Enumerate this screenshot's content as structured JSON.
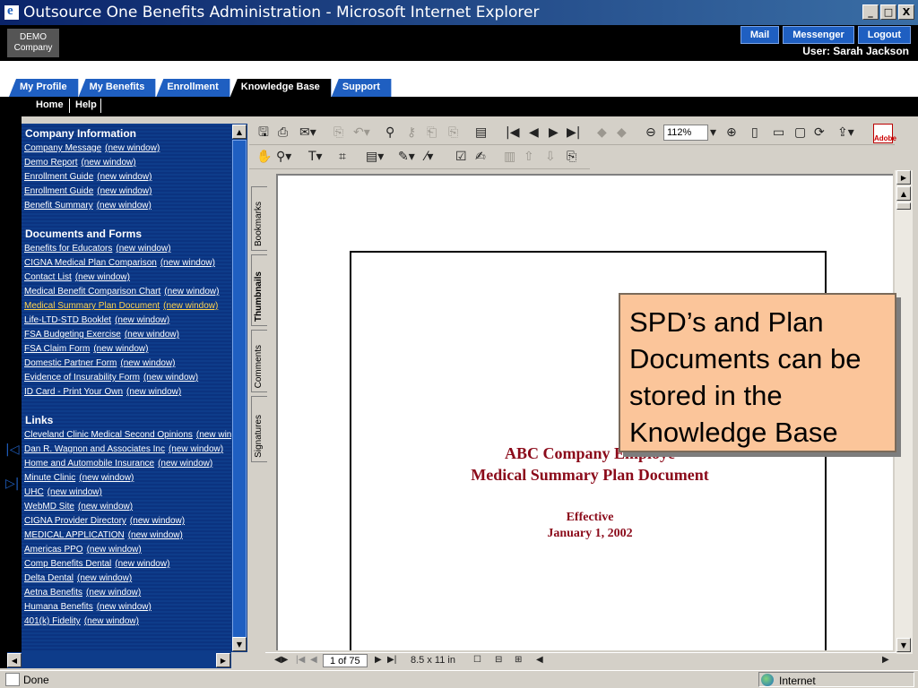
{
  "window": {
    "title": "Outsource One Benefits Administration - Microsoft Internet Explorer",
    "controls": [
      "_",
      "□",
      "X"
    ]
  },
  "header": {
    "logo_line1": "DEMO",
    "logo_line2": "Company",
    "buttons": [
      "Mail",
      "Messenger",
      "Logout"
    ],
    "user": "User: Sarah Jackson",
    "accent": "#1f5fc1"
  },
  "tabs": [
    "My Profile",
    "My Benefits",
    "Enrollment",
    "Knowledge Base",
    "Support"
  ],
  "active_tab": "Knowledge Base",
  "subnav": [
    "Home",
    "Help"
  ],
  "knowledge_base": {
    "sections": [
      {
        "title": "Company Information",
        "links": [
          {
            "text": "Company Message",
            "suffix": "(new window)"
          },
          {
            "text": "Demo Report",
            "suffix": "(new window)"
          },
          {
            "text": "Enrollment Guide",
            "suffix": "(new window)"
          },
          {
            "text": "Enrollment Guide",
            "suffix": "(new window)"
          },
          {
            "text": "Benefit Summary",
            "suffix": "(new window)"
          }
        ]
      },
      {
        "title": "Documents and Forms",
        "links": [
          {
            "text": "Benefits for Educators",
            "suffix": "(new window)"
          },
          {
            "text": "CIGNA Medical Plan Comparison",
            "suffix": "(new window)"
          },
          {
            "text": "Contact List",
            "suffix": "(new window)"
          },
          {
            "text": "Medical Benefit Comparison Chart",
            "suffix": "(new window)"
          },
          {
            "text": "Medical Summary Plan Document",
            "suffix": "(new window)"
          },
          {
            "text": "Life-LTD-STD Booklet",
            "suffix": "(new window)"
          },
          {
            "text": "FSA Budgeting Exercise",
            "suffix": "(new window)"
          },
          {
            "text": "FSA Claim Form",
            "suffix": "(new window)"
          },
          {
            "text": "Domestic Partner Form",
            "suffix": "(new window)"
          },
          {
            "text": "Evidence of Insurability Form",
            "suffix": "(new window)"
          },
          {
            "text": "ID Card - Print Your Own",
            "suffix": "(new window)"
          }
        ]
      },
      {
        "title": "Links",
        "links": [
          {
            "text": "Cleveland Clinic Medical Second Opinions",
            "suffix": "(new window)"
          },
          {
            "text": "Dan R. Wagnon and Associates Inc",
            "suffix": "(new window)"
          },
          {
            "text": "Home and Automobile Insurance",
            "suffix": "(new window)"
          },
          {
            "text": "Minute Clinic",
            "suffix": "(new window)"
          },
          {
            "text": "UHC",
            "suffix": "(new window)"
          },
          {
            "text": "WebMD Site",
            "suffix": "(new window)"
          },
          {
            "text": "CIGNA Provider Directory",
            "suffix": "(new window)"
          },
          {
            "text": "MEDICAL APPLICATION",
            "suffix": "(new window)"
          },
          {
            "text": "Americas PPO",
            "suffix": "(new window)"
          },
          {
            "text": "Comp Benefits Dental",
            "suffix": "(new window)"
          },
          {
            "text": "Delta Dental",
            "suffix": "(new window)"
          },
          {
            "text": "Aetna Benefits",
            "suffix": "(new window)"
          },
          {
            "text": "Humana Benefits",
            "suffix": "(new window)"
          },
          {
            "text": "401(k) Fidelity",
            "suffix": "(new window)"
          }
        ]
      }
    ],
    "highlighted_link": "Medical Summary Plan Document"
  },
  "viewer": {
    "zoom": "112%",
    "nav_tabs": [
      "Bookmarks",
      "Thumbnails",
      "Comments",
      "Signatures"
    ],
    "active_nav_tab": "Thumbnails",
    "page_indicator": "1 of 75",
    "page_size": "8.5 x 11 in",
    "acrobat_label": "Adobe",
    "document": {
      "title_line1": "ABC Company Employe",
      "title_line2": "Medical Summary Plan Document",
      "effective": "Effective",
      "date": "January 1, 2002",
      "text_color": "#8b0a1a"
    }
  },
  "callout": "SPD’s and Plan Documents can be stored in the Knowledge Base",
  "status": {
    "text": "Done",
    "zone": "Internet"
  }
}
